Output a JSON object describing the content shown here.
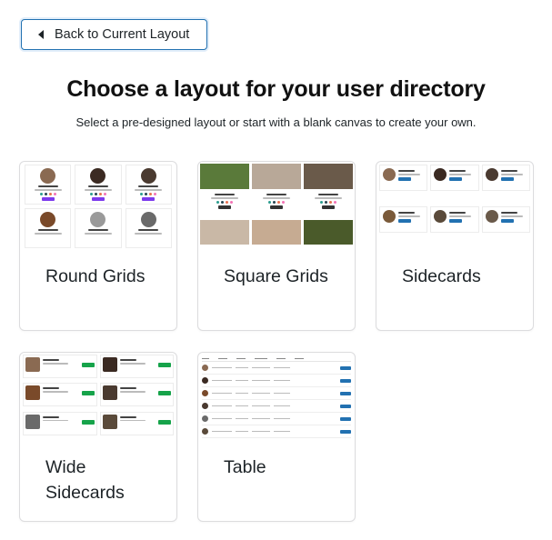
{
  "back_button": {
    "label": "Back to Current Layout",
    "icon": "chevron-left-icon"
  },
  "header": {
    "title": "Choose a layout for your user directory",
    "subtitle": "Select a pre-designed layout or start with a blank canvas to create your own."
  },
  "layouts": [
    {
      "id": "round-grids",
      "label": "Round Grids"
    },
    {
      "id": "square-grids",
      "label": "Square Grids"
    },
    {
      "id": "sidecards",
      "label": "Sidecards"
    },
    {
      "id": "wide-sidecards",
      "label": "Wide Sidecards"
    },
    {
      "id": "table",
      "label": "Table"
    }
  ],
  "colors": {
    "accent": "#2271b1",
    "purple_button": "#7c3aed",
    "green_button": "#16a34a",
    "card_border": "#dcdcde"
  }
}
